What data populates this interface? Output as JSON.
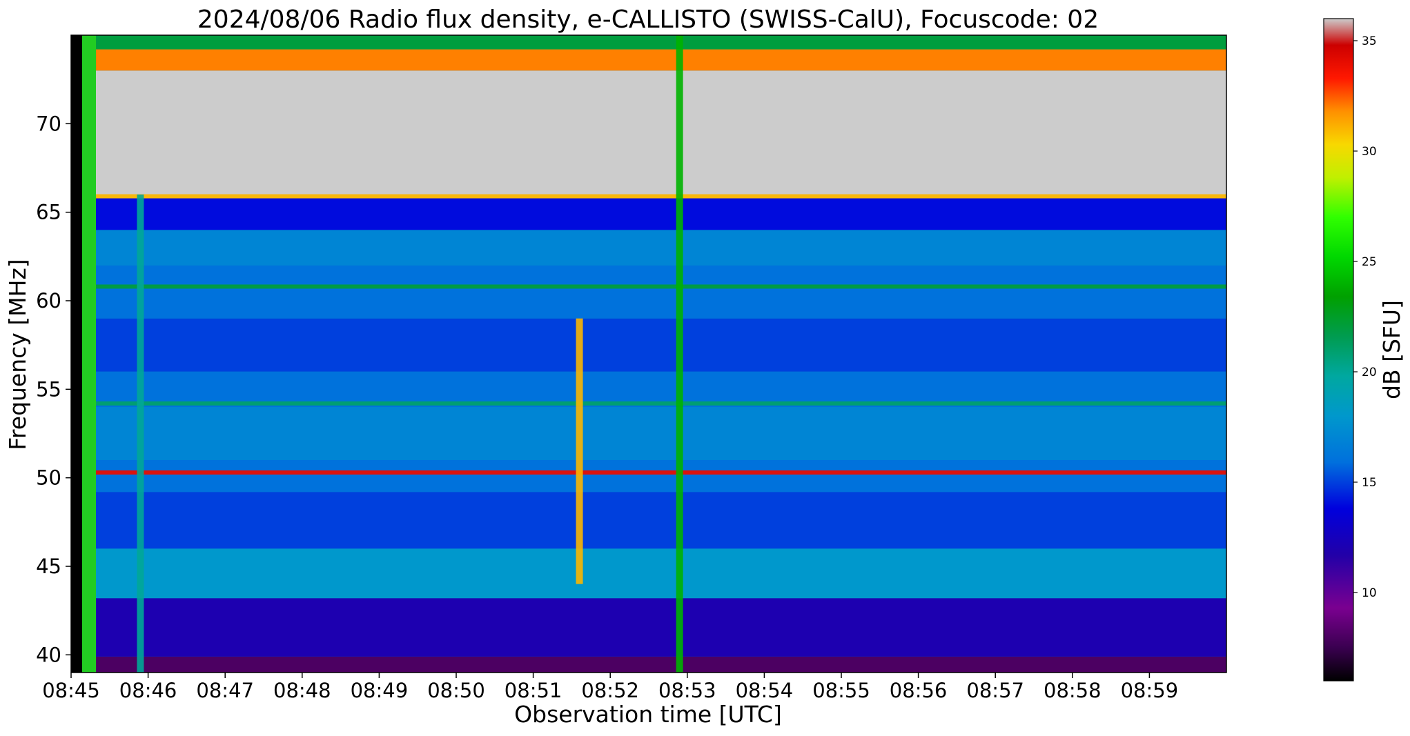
{
  "chart_data": {
    "type": "heatmap",
    "title": "2024/08/06  Radio flux density, e-CALLISTO (SWISS-CalU), Focuscode: 02",
    "xlabel": "Observation time [UTC]",
    "ylabel": "Frequency [MHz]",
    "x_range": [
      "08:45",
      "09:00"
    ],
    "y_range_mhz": [
      39,
      75
    ],
    "x_ticks": [
      "08:45",
      "08:46",
      "08:47",
      "08:48",
      "08:49",
      "08:50",
      "08:51",
      "08:52",
      "08:53",
      "08:54",
      "08:55",
      "08:56",
      "08:57",
      "08:58",
      "08:59"
    ],
    "y_ticks": [
      40,
      45,
      50,
      55,
      60,
      65,
      70
    ],
    "colorbar": {
      "label": "dB [SFU]",
      "range": [
        6,
        36
      ],
      "ticks": [
        10,
        15,
        20,
        25,
        30,
        35
      ],
      "colormap": "nipy_spectral-like"
    },
    "frequency_bands_db": [
      {
        "from_mhz": 39,
        "to_mhz": 39.9,
        "db": 8
      },
      {
        "from_mhz": 39.9,
        "to_mhz": 43.2,
        "db": 12
      },
      {
        "from_mhz": 43.2,
        "to_mhz": 46,
        "db": 18
      },
      {
        "from_mhz": 46,
        "to_mhz": 49.2,
        "db": 15
      },
      {
        "from_mhz": 49.2,
        "to_mhz": 51,
        "db": 16
      },
      {
        "from_mhz": 51,
        "to_mhz": 54,
        "db": 17
      },
      {
        "from_mhz": 54,
        "to_mhz": 56,
        "db": 16
      },
      {
        "from_mhz": 56,
        "to_mhz": 59,
        "db": 15
      },
      {
        "from_mhz": 59,
        "to_mhz": 62,
        "db": 16
      },
      {
        "from_mhz": 62,
        "to_mhz": 64,
        "db": 17
      },
      {
        "from_mhz": 64,
        "to_mhz": 65.8,
        "db": 14
      },
      {
        "from_mhz": 65.8,
        "to_mhz": 73,
        "db": 36
      },
      {
        "from_mhz": 73,
        "to_mhz": 74.2,
        "db": 32
      },
      {
        "from_mhz": 74.2,
        "to_mhz": 75,
        "db": 22
      }
    ],
    "emission_lines": [
      {
        "freq_mhz": 50.3,
        "db": 34
      },
      {
        "freq_mhz": 60.8,
        "db": 22
      },
      {
        "freq_mhz": 54.2,
        "db": 21
      },
      {
        "freq_mhz": 65.9,
        "db": 31
      }
    ],
    "bursts": [
      {
        "time": "08:51:36",
        "freq_range_mhz": [
          44,
          59
        ],
        "peak_db": 31
      },
      {
        "time": "08:52:54",
        "freq_range_mhz": [
          39,
          75
        ],
        "peak_db": 24
      },
      {
        "time": "08:45:54",
        "freq_range_mhz": [
          39,
          66
        ],
        "peak_db": 20
      }
    ]
  }
}
